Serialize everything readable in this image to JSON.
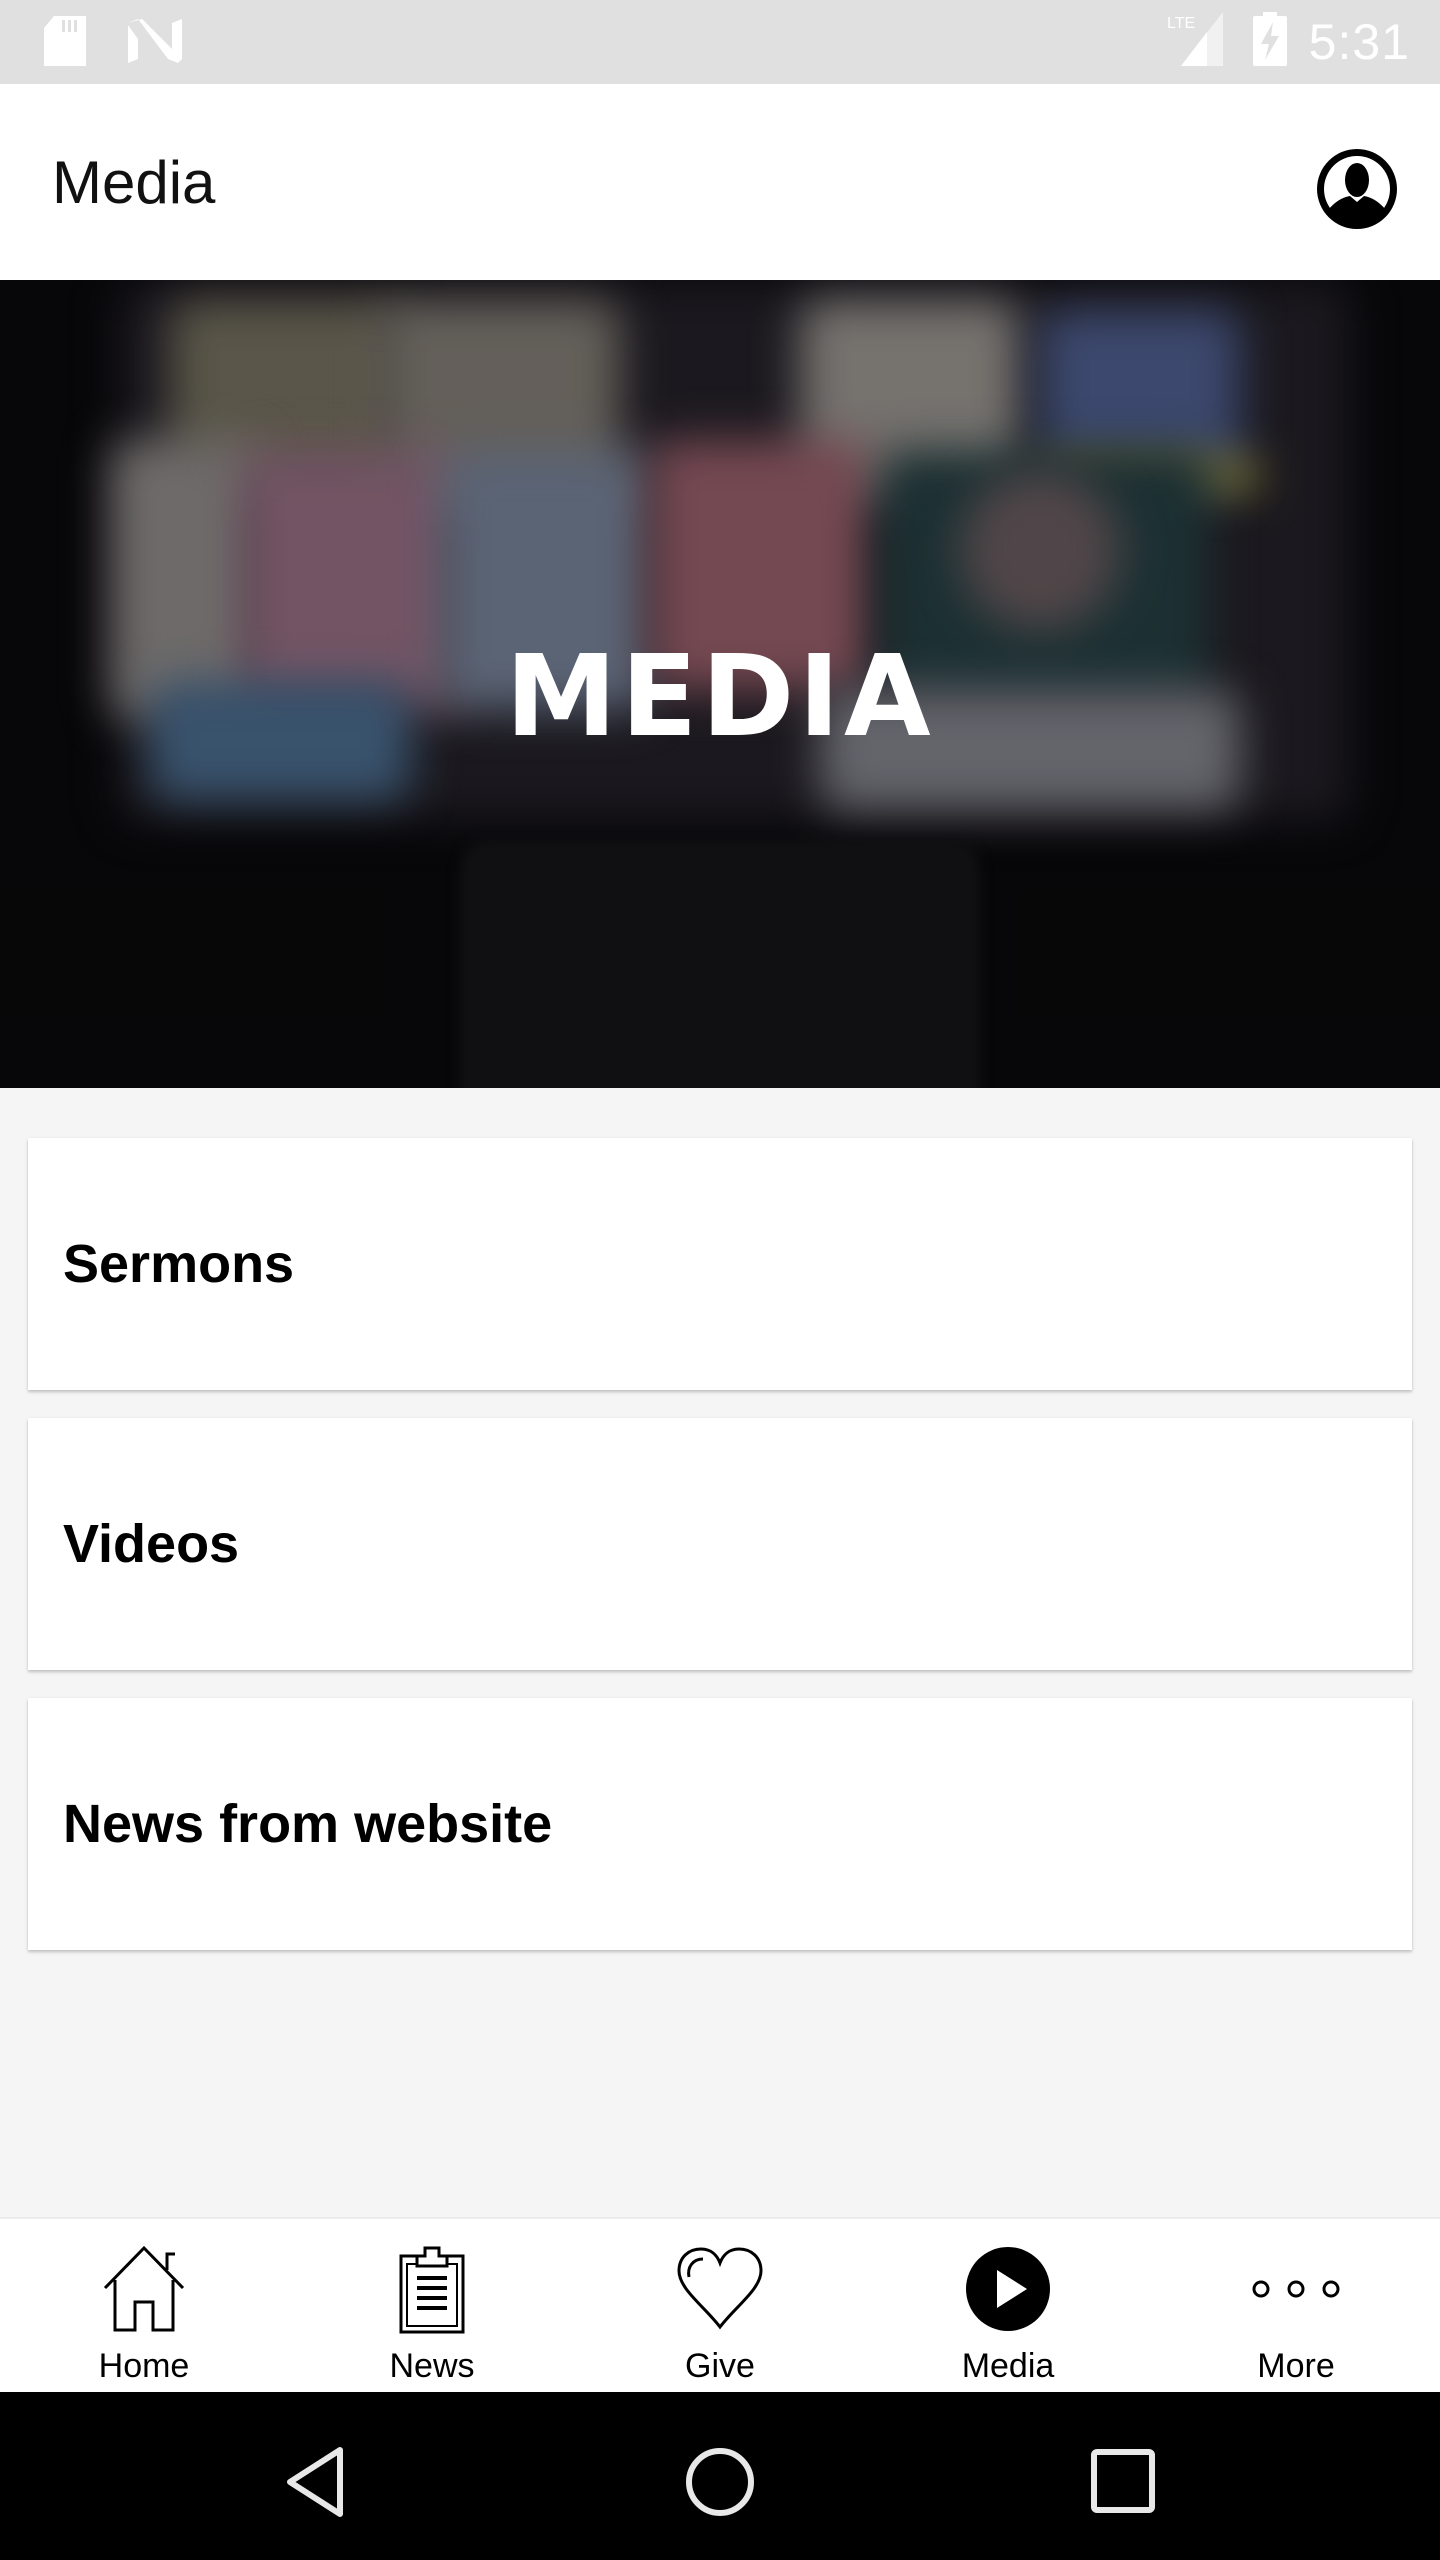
{
  "status_bar": {
    "time": "5:31",
    "network_label": "LTE",
    "icons": [
      "sd-card-icon",
      "n-notification-icon",
      "lte-signal-icon",
      "battery-charging-icon"
    ]
  },
  "app_bar": {
    "title": "Media",
    "profile_icon": "account-circle-icon"
  },
  "hero": {
    "title": "MEDIA",
    "image": "blurred-tv-with-remote"
  },
  "cards": [
    {
      "label": "Sermons"
    },
    {
      "label": "Videos"
    },
    {
      "label": "News from website"
    }
  ],
  "bottom_nav": {
    "active": "Media",
    "items": [
      {
        "label": "Home",
        "icon": "home-icon"
      },
      {
        "label": "News",
        "icon": "clipboard-icon"
      },
      {
        "label": "Give",
        "icon": "heart-icon"
      },
      {
        "label": "Media",
        "icon": "play-circle-icon"
      },
      {
        "label": "More",
        "icon": "more-dots-icon"
      }
    ]
  },
  "system_nav": {
    "buttons": [
      "back",
      "home",
      "recents"
    ]
  },
  "colors": {
    "status_bar_bg": "#e0e0e0",
    "page_bg": "#f5f5f5",
    "card_bg": "#ffffff",
    "text": "#000000",
    "system_nav_bg": "#000000"
  }
}
